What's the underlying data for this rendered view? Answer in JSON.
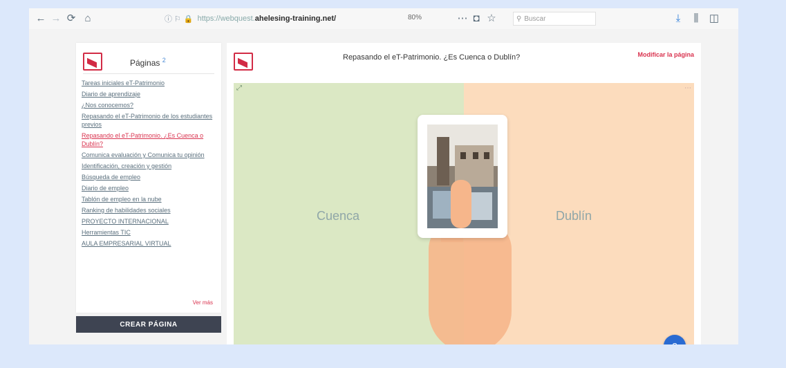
{
  "browser": {
    "url_info": "ⓘ",
    "url_prefix": "https://webquest.",
    "url_domain": "ahelesing-training.net/",
    "zoom": "80%",
    "search_placeholder": "Buscar"
  },
  "sidebar": {
    "title": "Páginas",
    "title_badge": "2",
    "items": [
      {
        "label": "Tareas iniciales eT-Patrimonio"
      },
      {
        "label": "Diario de aprendizaje"
      },
      {
        "label": "¿Nos conocemos?"
      },
      {
        "label": "Repasando el eT-Patrimonio de los estudiantes previos"
      },
      {
        "label": "Repasando el eT-Patrimonio. ¿Es Cuenca o Dublín?"
      },
      {
        "label": "Comunica evaluación y Comunica tu opinión"
      },
      {
        "label": "Identificación, creación y gestión"
      },
      {
        "label": "Búsqueda de empleo"
      },
      {
        "label": "Diario de empleo"
      },
      {
        "label": "Tablón de empleo en la nube"
      },
      {
        "label": "Ranking de habilidades sociales"
      },
      {
        "label": "PROYECTO INTERNACIONAL"
      },
      {
        "label": "Herramientas TIC"
      },
      {
        "label": "AULA EMPRESARIAL VIRTUAL"
      }
    ],
    "more_label": "Ver más",
    "create_button": "CREAR PÁGINA"
  },
  "main": {
    "title": "Repasando el eT-Patrimonio. ¿Es Cuenca o Dublín?",
    "edit_link": "Modificar la página",
    "left_zone": "Cuenca",
    "right_zone": "Dublín",
    "fab_label": "?"
  },
  "colors": {
    "accent": "#d9334f",
    "left_zone_bg": "#dbe8c4",
    "right_zone_bg": "#fcdcbd",
    "button_dark": "#3e4452",
    "fab_blue": "#2a6bd2"
  }
}
